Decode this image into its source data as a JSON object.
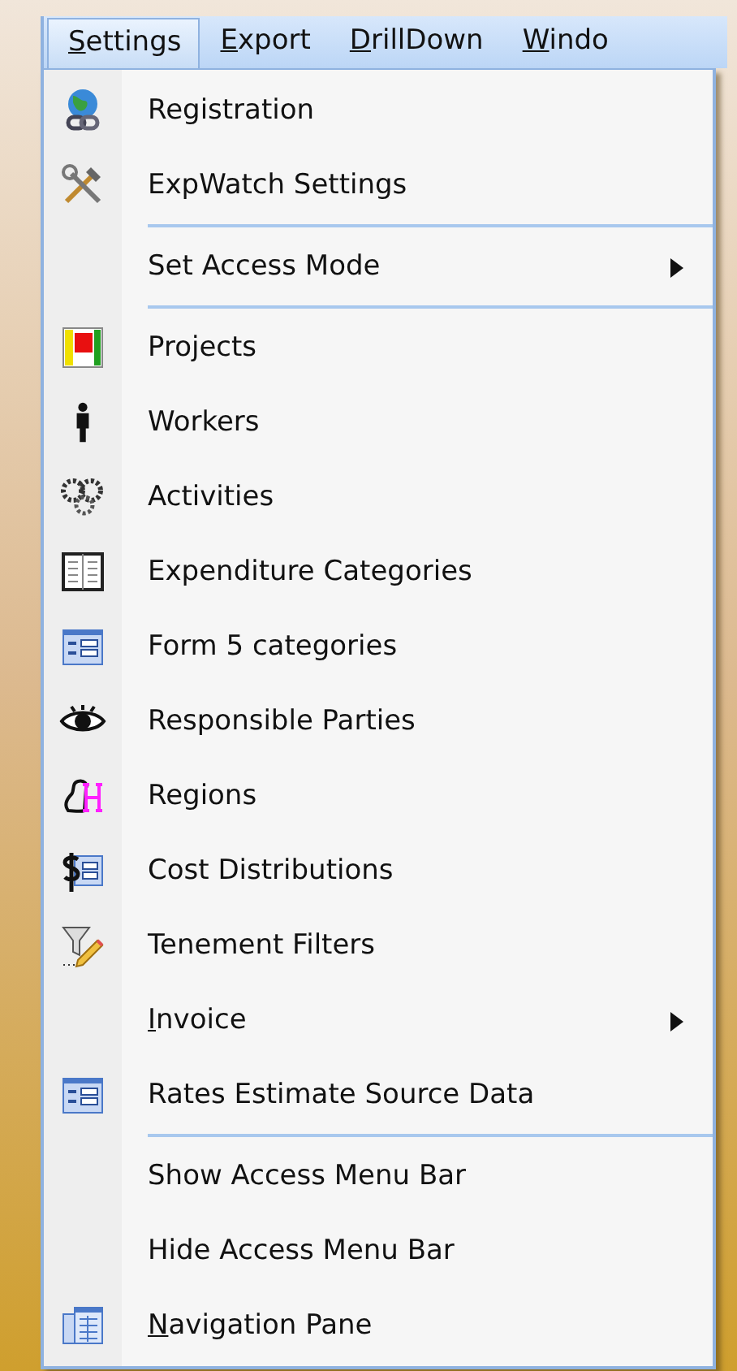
{
  "menu_bar": [
    {
      "label": "Settings",
      "selected": true,
      "underline_first": true
    },
    {
      "label": "Export",
      "selected": false,
      "underline_first": true
    },
    {
      "label": "DrillDown",
      "selected": false,
      "underline_first": true
    },
    {
      "label": "Windo",
      "selected": false,
      "underline_first": true
    }
  ],
  "menu": [
    {
      "label": "Registration",
      "submenu": false,
      "separator_above": false,
      "underline_first": false
    },
    {
      "label": "ExpWatch Settings",
      "submenu": false,
      "separator_above": false,
      "underline_first": false
    },
    {
      "label": "Set Access Mode",
      "submenu": true,
      "separator_above": true,
      "underline_first": false
    },
    {
      "label": "Projects",
      "submenu": false,
      "separator_above": true,
      "underline_first": false
    },
    {
      "label": "Workers",
      "submenu": false,
      "separator_above": false,
      "underline_first": false
    },
    {
      "label": "Activities",
      "submenu": false,
      "separator_above": false,
      "underline_first": false
    },
    {
      "label": "Expenditure Categories",
      "submenu": false,
      "separator_above": false,
      "underline_first": false
    },
    {
      "label": "Form 5 categories",
      "submenu": false,
      "separator_above": false,
      "underline_first": false
    },
    {
      "label": "Responsible Parties",
      "submenu": false,
      "separator_above": false,
      "underline_first": false
    },
    {
      "label": "Regions",
      "submenu": false,
      "separator_above": false,
      "underline_first": false
    },
    {
      "label": "Cost Distributions",
      "submenu": false,
      "separator_above": false,
      "underline_first": false
    },
    {
      "label": "Tenement Filters",
      "submenu": false,
      "separator_above": false,
      "underline_first": false
    },
    {
      "label": "Invoice",
      "submenu": true,
      "separator_above": false,
      "underline_first": true
    },
    {
      "label": "Rates Estimate Source Data",
      "submenu": false,
      "separator_above": false,
      "underline_first": false
    },
    {
      "label": "Show Access Menu Bar",
      "submenu": false,
      "separator_above": true,
      "underline_first": false
    },
    {
      "label": "Hide Access Menu Bar",
      "submenu": false,
      "separator_above": false,
      "underline_first": false
    },
    {
      "label": "Navigation Pane",
      "submenu": false,
      "separator_above": false,
      "underline_first": true
    }
  ]
}
